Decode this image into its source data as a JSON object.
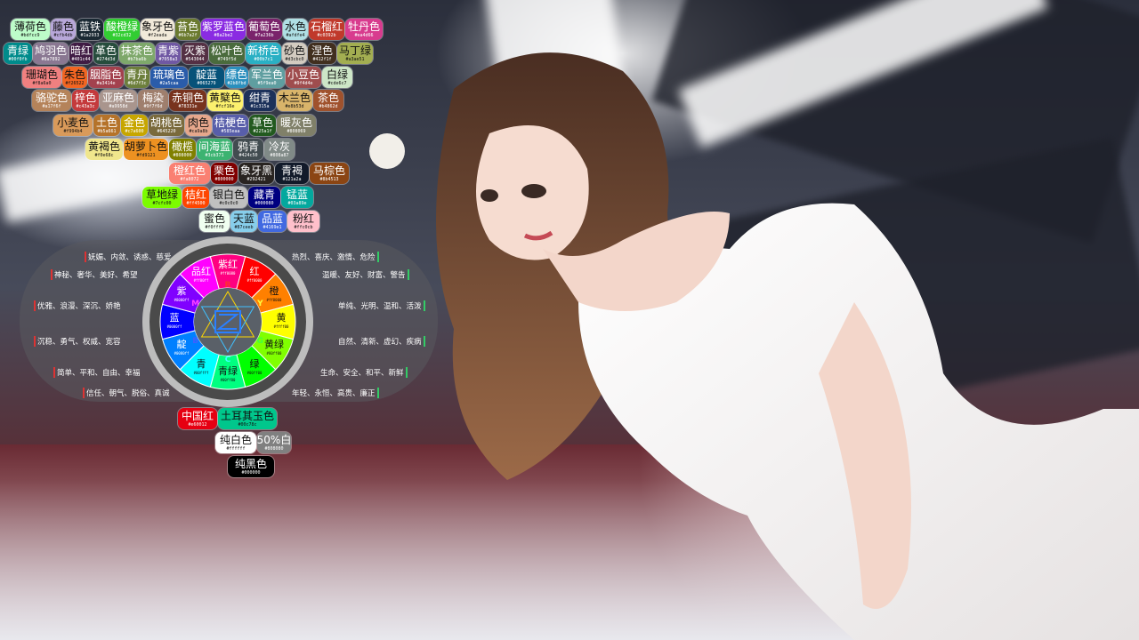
{
  "swatches": [
    {
      "name": "薄荷色",
      "hex": "#bdfcc9",
      "bg": "#bdfcc9",
      "fg": "lt"
    },
    {
      "name": "藤色",
      "hex": "#cfb4db",
      "bg": "#b7a7d9",
      "fg": "lt"
    },
    {
      "name": "蓝铁",
      "hex": "#1a2933",
      "bg": "#1a2933",
      "fg": "dk"
    },
    {
      "name": "酸橙绿",
      "hex": "#32cd32",
      "bg": "#32cd32",
      "fg": "dk"
    },
    {
      "name": "象牙色",
      "hex": "#f2eada",
      "bg": "#f2eada",
      "fg": "lt"
    },
    {
      "name": "苔色",
      "hex": "#6b7a2f",
      "bg": "#6b7a2f",
      "fg": "dk"
    },
    {
      "name": "紫罗蓝色",
      "hex": "#8a2be2",
      "bg": "#8a2be2",
      "fg": "dk"
    },
    {
      "name": "葡萄色",
      "hex": "#7a236b",
      "bg": "#7a236b",
      "fg": "dk"
    },
    {
      "name": "水色",
      "hex": "#afdfe4",
      "bg": "#afdfe4",
      "fg": "lt"
    },
    {
      "name": "石榴红",
      "hex": "#c0392b",
      "bg": "#c0392b",
      "fg": "dk"
    },
    {
      "name": "牡丹色",
      "hex": "#ea4d66",
      "bg": "#d83b8e",
      "fg": "dk"
    },
    {
      "name": "青绿",
      "hex": "#00f0fb",
      "bg": "#008b8b",
      "fg": "dk"
    },
    {
      "name": "鸠羽色",
      "hex": "#8a7892",
      "bg": "#8a7892",
      "fg": "dk"
    },
    {
      "name": "暗红",
      "hex": "#401c44",
      "bg": "#401c44",
      "fg": "dk"
    },
    {
      "name": "革色",
      "hex": "#274d3d",
      "bg": "#274d3d",
      "fg": "dk"
    },
    {
      "name": "抹茶色",
      "hex": "#b7ba6b",
      "bg": "#7ea86b",
      "fg": "dk"
    },
    {
      "name": "青紫",
      "hex": "#7058a3",
      "bg": "#7058a3",
      "fg": "dk"
    },
    {
      "name": "灭紫",
      "hex": "#543044",
      "bg": "#543044",
      "fg": "dk"
    },
    {
      "name": "松叶色",
      "hex": "#749f5d",
      "bg": "#4a6b3d",
      "fg": "dk"
    },
    {
      "name": "新桥色",
      "hex": "#00b7c1",
      "bg": "#2ab0c4",
      "fg": "dk"
    },
    {
      "name": "砂色",
      "hex": "#d3cbc0",
      "bg": "#d3cbc0",
      "fg": "lt"
    },
    {
      "name": "涅色",
      "hex": "#412f1f",
      "bg": "#412f1f",
      "fg": "dk"
    },
    {
      "name": "马丁绿",
      "hex": "#a3ae51",
      "bg": "#a3ae51",
      "fg": "lt"
    },
    {
      "name": "珊瑚色",
      "hex": "#f8a6a0",
      "bg": "#f08080",
      "fg": "lt"
    },
    {
      "name": "朱色",
      "hex": "#f26522",
      "bg": "#f26522",
      "fg": "lt"
    },
    {
      "name": "胭脂色",
      "hex": "#a3414e",
      "bg": "#a3414e",
      "fg": "dk"
    },
    {
      "name": "青丹",
      "hex": "#6d7f3c",
      "bg": "#6d7f3c",
      "fg": "dk"
    },
    {
      "name": "琉璃色",
      "hex": "#2a5caa",
      "bg": "#2a5caa",
      "fg": "dk"
    },
    {
      "name": "靛蓝",
      "hex": "#065279",
      "bg": "#065279",
      "fg": "dk"
    },
    {
      "name": "缥色",
      "hex": "#2b8fbd",
      "bg": "#2b8fbd",
      "fg": "dk"
    },
    {
      "name": "军兰色",
      "hex": "#5f9ea0",
      "bg": "#5f9ea0",
      "fg": "dk"
    },
    {
      "name": "小豆色",
      "hex": "#9f4d4e",
      "bg": "#9f4d4e",
      "fg": "dk"
    },
    {
      "name": "白绿",
      "hex": "#cde6c7",
      "bg": "#cde6c7",
      "fg": "lt"
    },
    {
      "name": "骆驼色",
      "hex": "#a17f6f",
      "bg": "#b5835a",
      "fg": "dk"
    },
    {
      "name": "梓色",
      "hex": "#c43a3c",
      "bg": "#c43a3c",
      "fg": "dk"
    },
    {
      "name": "亚麻色",
      "hex": "#a9958d",
      "bg": "#a9958d",
      "fg": "dk"
    },
    {
      "name": "梅染",
      "hex": "#9f7f6d",
      "bg": "#9f7f6d",
      "fg": "dk"
    },
    {
      "name": "赤铜色",
      "hex": "#78331e",
      "bg": "#78331e",
      "fg": "dk"
    },
    {
      "name": "黄櫱色",
      "hex": "#fcf16e",
      "bg": "#fcf16e",
      "fg": "lt"
    },
    {
      "name": "绀青",
      "hex": "#1c315a",
      "bg": "#1c315a",
      "fg": "dk"
    },
    {
      "name": "木兰色",
      "hex": "#e8b53d",
      "bg": "#d9b46a",
      "fg": "lt"
    },
    {
      "name": "茶色",
      "hex": "#b4862d",
      "bg": "#a0522d",
      "fg": "dk"
    },
    {
      "name": "小麦色",
      "hex": "#f994b4",
      "bg": "#d99a5a",
      "fg": "lt"
    },
    {
      "name": "土色",
      "hex": "#b5a661",
      "bg": "#b5732a",
      "fg": "dk"
    },
    {
      "name": "金色",
      "hex": "#c7a600",
      "bg": "#c7a600",
      "fg": "dk"
    },
    {
      "name": "胡桃色",
      "hex": "#645220",
      "bg": "#7a6a3c",
      "fg": "dk"
    },
    {
      "name": "肉色",
      "hex": "#ca9a8b",
      "bg": "#e6a78c",
      "fg": "lt"
    },
    {
      "name": "桔梗色",
      "hex": "#585eaa",
      "bg": "#585eaa",
      "fg": "dk"
    },
    {
      "name": "草色",
      "hex": "#225a1f",
      "bg": "#225a1f",
      "fg": "dk"
    },
    {
      "name": "暖灰色",
      "hex": "#808069",
      "bg": "#808069",
      "fg": "dk"
    },
    {
      "name": "黄褐色",
      "hex": "#f0e68c",
      "bg": "#f0e68c",
      "fg": "lt"
    },
    {
      "name": "胡萝卜色",
      "hex": "#fd9121",
      "bg": "#ed9121",
      "fg": "lt"
    },
    {
      "name": "橄榄",
      "hex": "#808000",
      "bg": "#808000",
      "fg": "dk"
    },
    {
      "name": "间海蓝",
      "hex": "#3cb371",
      "bg": "#3cb371",
      "fg": "dk"
    },
    {
      "name": "鸦青",
      "hex": "#424c50",
      "bg": "#424c50",
      "fg": "dk"
    },
    {
      "name": "冷灰",
      "hex": "#808a87",
      "bg": "#808a87",
      "fg": "dk"
    },
    {
      "name": "橙红色",
      "hex": "#fa8072",
      "bg": "#fa8072",
      "fg": "dk"
    },
    {
      "name": "栗色",
      "hex": "#800000",
      "bg": "#800000",
      "fg": "dk"
    },
    {
      "name": "象牙黑",
      "hex": "#292421",
      "bg": "#292421",
      "fg": "dk"
    },
    {
      "name": "青褐",
      "hex": "#121a2a",
      "bg": "#121a2a",
      "fg": "dk"
    },
    {
      "name": "马棕色",
      "hex": "#8b4513",
      "bg": "#8b4513",
      "fg": "dk"
    },
    {
      "name": "草地绿",
      "hex": "#7cfc00",
      "bg": "#7cfc00",
      "fg": "lt"
    },
    {
      "name": "桔红",
      "hex": "#ff4500",
      "bg": "#ff4500",
      "fg": "dk"
    },
    {
      "name": "银白色",
      "hex": "#c0c0c0",
      "bg": "#c0c0c0",
      "fg": "lt"
    },
    {
      "name": "藏青",
      "hex": "#000080",
      "bg": "#000080",
      "fg": "dk"
    },
    {
      "name": "锰蓝",
      "hex": "#03a89e",
      "bg": "#03a89e",
      "fg": "dk"
    },
    {
      "name": "蜜色",
      "hex": "#f0fff0",
      "bg": "#f0fff0",
      "fg": "lt"
    },
    {
      "name": "天蓝",
      "hex": "#87ceeb",
      "bg": "#87ceeb",
      "fg": "lt"
    },
    {
      "name": "品蓝",
      "hex": "#4169e1",
      "bg": "#4169e1",
      "fg": "dk"
    },
    {
      "name": "粉红",
      "hex": "#ffc0cb",
      "bg": "#ffc0cb",
      "fg": "lt"
    },
    {
      "name": "中国红",
      "hex": "#e60012",
      "bg": "#e60012",
      "fg": "dk"
    },
    {
      "name": "土耳其玉色",
      "hex": "#00c78c",
      "bg": "#00c78c",
      "fg": "lt"
    },
    {
      "name": "纯白色",
      "hex": "#ffffff",
      "bg": "#ffffff",
      "fg": "lt"
    },
    {
      "name": "50%白",
      "hex": "#808080",
      "bg": "#808080",
      "fg": "dk"
    },
    {
      "name": "纯黑色",
      "hex": "#000000",
      "bg": "#000000",
      "fg": "dk"
    }
  ],
  "wheel": {
    "segments": [
      {
        "name": "紫红",
        "hex": "#ff0080",
        "color": "#ff0080"
      },
      {
        "name": "红",
        "hex": "#ff0000",
        "color": "#ff0000"
      },
      {
        "name": "橙",
        "hex": "#ff8000",
        "color": "#ff8000"
      },
      {
        "name": "黄",
        "hex": "#ffff00",
        "color": "#ffff00"
      },
      {
        "name": "黄绿",
        "hex": "#80ff00",
        "color": "#80ff00"
      },
      {
        "name": "绿",
        "hex": "#00ff00",
        "color": "#00ff00"
      },
      {
        "name": "青绿",
        "hex": "#00ff80",
        "color": "#00ff80"
      },
      {
        "name": "青",
        "hex": "#00ffff",
        "color": "#00ffff"
      },
      {
        "name": "靛",
        "hex": "#0080ff",
        "color": "#0080ff"
      },
      {
        "name": "蓝",
        "hex": "#0000ff",
        "color": "#0000ff"
      },
      {
        "name": "紫",
        "hex": "#8000ff",
        "color": "#8000ff"
      },
      {
        "name": "品红",
        "hex": "#ff00ff",
        "color": "#ff00ff"
      }
    ],
    "letters": [
      "R",
      "Y",
      "G",
      "C",
      "B",
      "M"
    ]
  },
  "keywords_left": [
    "妩媚、内敛、诱惑、慈爱",
    "神秘、奢华、美好、希望",
    "优雅、浪漫、深沉、娇艳",
    "沉稳、勇气、权威、宽容",
    "简单、平和、自由、幸福",
    "信任、朝气、脱俗、真诚"
  ],
  "keywords_right": [
    "热烈、喜庆、激情、危险",
    "温暖、友好、财富、警告",
    "单纯、光明、温和、活泼",
    "自然、清新、虚幻、疾病",
    "生命、安全、和平、新鲜",
    "年轻、永恒、高贵、廉正"
  ]
}
